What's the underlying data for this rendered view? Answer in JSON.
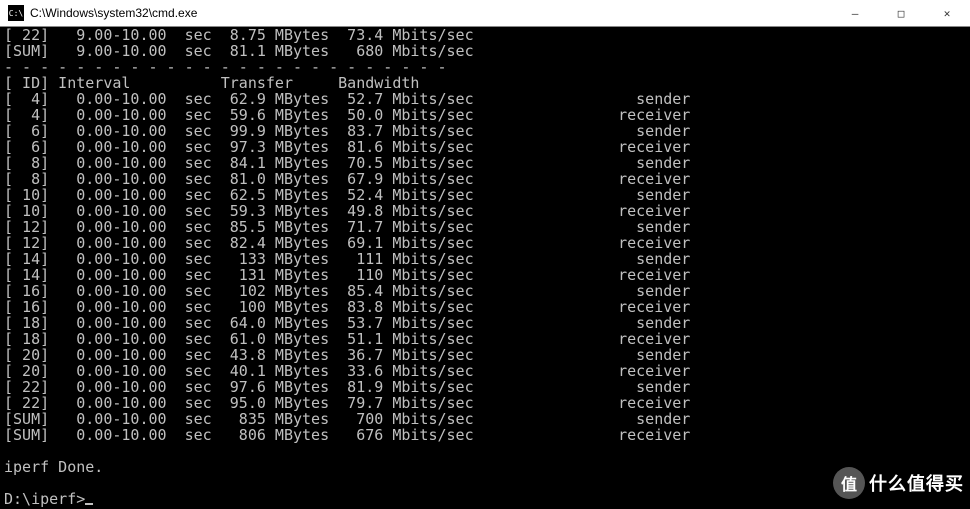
{
  "window": {
    "icon_text": "C:\\",
    "title": "C:\\Windows\\system32\\cmd.exe",
    "controls": {
      "minimize": "—",
      "maximize": "□",
      "close": "✕"
    }
  },
  "terminal": {
    "pre_rows": [
      {
        "id": "[ 22]",
        "interval": "  9.00-10.00",
        "unit": "sec",
        "transfer": "8.75 MBytes",
        "bandwidth": "73.4 Mbits/sec",
        "role": ""
      },
      {
        "id": "[SUM]",
        "interval": "  9.00-10.00",
        "unit": "sec",
        "transfer": "81.1 MBytes",
        "bandwidth": " 680 Mbits/sec",
        "role": ""
      }
    ],
    "separator": "- - - - - - - - - - - - - - - - - - - - - - - - -",
    "header": {
      "id": "[ ID]",
      "interval": "Interval",
      "transfer": "Transfer",
      "bandwidth": "Bandwidth"
    },
    "rows": [
      {
        "id": "[  4]",
        "interval": "  0.00-10.00",
        "unit": "sec",
        "transfer": "62.9 MBytes",
        "bandwidth": "52.7 Mbits/sec",
        "role": "sender"
      },
      {
        "id": "[  4]",
        "interval": "  0.00-10.00",
        "unit": "sec",
        "transfer": "59.6 MBytes",
        "bandwidth": "50.0 Mbits/sec",
        "role": "receiver"
      },
      {
        "id": "[  6]",
        "interval": "  0.00-10.00",
        "unit": "sec",
        "transfer": "99.9 MBytes",
        "bandwidth": "83.7 Mbits/sec",
        "role": "sender"
      },
      {
        "id": "[  6]",
        "interval": "  0.00-10.00",
        "unit": "sec",
        "transfer": "97.3 MBytes",
        "bandwidth": "81.6 Mbits/sec",
        "role": "receiver"
      },
      {
        "id": "[  8]",
        "interval": "  0.00-10.00",
        "unit": "sec",
        "transfer": "84.1 MBytes",
        "bandwidth": "70.5 Mbits/sec",
        "role": "sender"
      },
      {
        "id": "[  8]",
        "interval": "  0.00-10.00",
        "unit": "sec",
        "transfer": "81.0 MBytes",
        "bandwidth": "67.9 Mbits/sec",
        "role": "receiver"
      },
      {
        "id": "[ 10]",
        "interval": "  0.00-10.00",
        "unit": "sec",
        "transfer": "62.5 MBytes",
        "bandwidth": "52.4 Mbits/sec",
        "role": "sender"
      },
      {
        "id": "[ 10]",
        "interval": "  0.00-10.00",
        "unit": "sec",
        "transfer": "59.3 MBytes",
        "bandwidth": "49.8 Mbits/sec",
        "role": "receiver"
      },
      {
        "id": "[ 12]",
        "interval": "  0.00-10.00",
        "unit": "sec",
        "transfer": "85.5 MBytes",
        "bandwidth": "71.7 Mbits/sec",
        "role": "sender"
      },
      {
        "id": "[ 12]",
        "interval": "  0.00-10.00",
        "unit": "sec",
        "transfer": "82.4 MBytes",
        "bandwidth": "69.1 Mbits/sec",
        "role": "receiver"
      },
      {
        "id": "[ 14]",
        "interval": "  0.00-10.00",
        "unit": "sec",
        "transfer": " 133 MBytes",
        "bandwidth": " 111 Mbits/sec",
        "role": "sender"
      },
      {
        "id": "[ 14]",
        "interval": "  0.00-10.00",
        "unit": "sec",
        "transfer": " 131 MBytes",
        "bandwidth": " 110 Mbits/sec",
        "role": "receiver"
      },
      {
        "id": "[ 16]",
        "interval": "  0.00-10.00",
        "unit": "sec",
        "transfer": " 102 MBytes",
        "bandwidth": "85.4 Mbits/sec",
        "role": "sender"
      },
      {
        "id": "[ 16]",
        "interval": "  0.00-10.00",
        "unit": "sec",
        "transfer": " 100 MBytes",
        "bandwidth": "83.8 Mbits/sec",
        "role": "receiver"
      },
      {
        "id": "[ 18]",
        "interval": "  0.00-10.00",
        "unit": "sec",
        "transfer": "64.0 MBytes",
        "bandwidth": "53.7 Mbits/sec",
        "role": "sender"
      },
      {
        "id": "[ 18]",
        "interval": "  0.00-10.00",
        "unit": "sec",
        "transfer": "61.0 MBytes",
        "bandwidth": "51.1 Mbits/sec",
        "role": "receiver"
      },
      {
        "id": "[ 20]",
        "interval": "  0.00-10.00",
        "unit": "sec",
        "transfer": "43.8 MBytes",
        "bandwidth": "36.7 Mbits/sec",
        "role": "sender"
      },
      {
        "id": "[ 20]",
        "interval": "  0.00-10.00",
        "unit": "sec",
        "transfer": "40.1 MBytes",
        "bandwidth": "33.6 Mbits/sec",
        "role": "receiver"
      },
      {
        "id": "[ 22]",
        "interval": "  0.00-10.00",
        "unit": "sec",
        "transfer": "97.6 MBytes",
        "bandwidth": "81.9 Mbits/sec",
        "role": "sender"
      },
      {
        "id": "[ 22]",
        "interval": "  0.00-10.00",
        "unit": "sec",
        "transfer": "95.0 MBytes",
        "bandwidth": "79.7 Mbits/sec",
        "role": "receiver"
      },
      {
        "id": "[SUM]",
        "interval": "  0.00-10.00",
        "unit": "sec",
        "transfer": " 835 MBytes",
        "bandwidth": " 700 Mbits/sec",
        "role": "sender"
      },
      {
        "id": "[SUM]",
        "interval": "  0.00-10.00",
        "unit": "sec",
        "transfer": " 806 MBytes",
        "bandwidth": " 676 Mbits/sec",
        "role": "receiver"
      }
    ],
    "done": "iperf Done.",
    "prompt": "D:\\iperf>"
  },
  "watermark": {
    "badge": "值",
    "text": "什么值得买"
  }
}
